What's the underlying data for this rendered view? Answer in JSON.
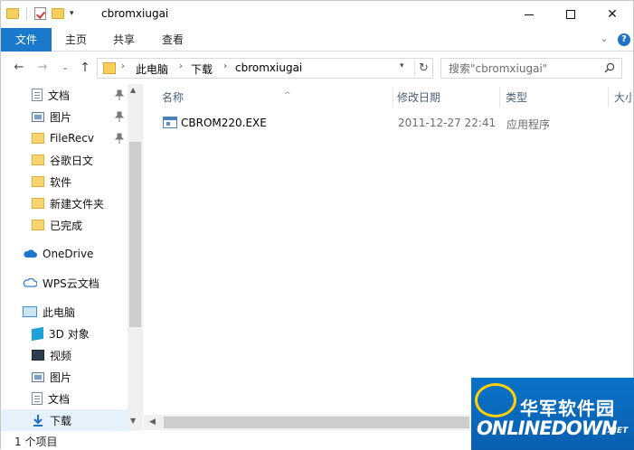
{
  "window": {
    "title": "cbromxiugai",
    "quick_access_dropdown": "▾",
    "min_label": "",
    "max_label": "",
    "close_label": "✕"
  },
  "ribbon": {
    "tabs": [
      "文件",
      "主页",
      "共享",
      "查看"
    ],
    "active_tab": "文件",
    "accent": "#1979ca",
    "help_label": "?"
  },
  "nav": {
    "back": "←",
    "forward": "→",
    "recent": "⌄",
    "up": "↑",
    "breadcrumb": [
      "此电脑",
      "下载",
      "cbromxiugai"
    ],
    "separator": "›",
    "search_placeholder": "搜索\"cbromxiugai\""
  },
  "navpane": {
    "items": [
      {
        "label": "文档",
        "icon": "document-icon",
        "pinned": true
      },
      {
        "label": "图片",
        "icon": "pictures-icon",
        "pinned": true
      },
      {
        "label": "FileRecv",
        "icon": "folder-icon",
        "pinned": true
      },
      {
        "label": "谷歌日文",
        "icon": "folder-icon",
        "pinned": false
      },
      {
        "label": "软件",
        "icon": "folder-icon",
        "pinned": false
      },
      {
        "label": "新建文件夹",
        "icon": "folder-icon",
        "pinned": false
      },
      {
        "label": "已完成",
        "icon": "folder-icon",
        "pinned": false
      },
      {
        "label": "OneDrive",
        "icon": "onedrive-icon",
        "pinned": false
      },
      {
        "label": "WPS云文档",
        "icon": "wps-cloud-icon",
        "pinned": false
      },
      {
        "label": "此电脑",
        "icon": "this-pc-icon",
        "pinned": false
      },
      {
        "label": "3D 对象",
        "icon": "3d-objects-icon",
        "pinned": false
      },
      {
        "label": "视频",
        "icon": "video-icon",
        "pinned": false
      },
      {
        "label": "图片",
        "icon": "pictures-icon",
        "pinned": false
      },
      {
        "label": "文档",
        "icon": "document-icon",
        "pinned": false
      },
      {
        "label": "下载",
        "icon": "download-icon",
        "pinned": false,
        "selected": true
      }
    ]
  },
  "columns": [
    "名称",
    "修改日期",
    "类型",
    "大小"
  ],
  "files": [
    {
      "name": "CBROM220.EXE",
      "modified": "2011-12-27 22:41",
      "type": "应用程序"
    }
  ],
  "status": {
    "item_count": "1 个项目"
  },
  "watermark": {
    "cn": "华军软件园",
    "en": "ONLINEDOWN",
    "suffix": ".NET"
  }
}
